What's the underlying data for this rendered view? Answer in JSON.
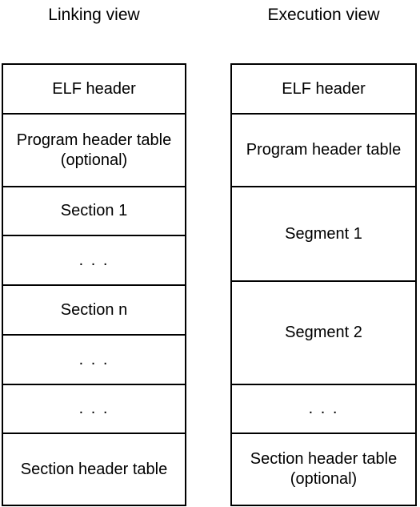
{
  "diagram": {
    "title_linking": "Linking view",
    "title_execution": "Execution view",
    "linking_view": {
      "title": "Linking view",
      "rows": [
        {
          "label": "ELF header",
          "height": 62,
          "kind": "header"
        },
        {
          "label": "Program header table (optional)",
          "height": 91,
          "kind": "table"
        },
        {
          "label": "Section 1",
          "height": 61,
          "kind": "section"
        },
        {
          "label": ". . .",
          "height": 62,
          "kind": "ellipsis"
        },
        {
          "label": "Section n",
          "height": 62,
          "kind": "section"
        },
        {
          "label": ". . .",
          "height": 62,
          "kind": "ellipsis"
        },
        {
          "label": ". . .",
          "height": 61,
          "kind": "ellipsis"
        },
        {
          "label": "Section header table",
          "height": 90,
          "kind": "table"
        }
      ]
    },
    "execution_view": {
      "title": "Execution view",
      "rows": [
        {
          "label": "ELF header",
          "height": 62,
          "kind": "header"
        },
        {
          "label": "Program header table",
          "height": 91,
          "kind": "table"
        },
        {
          "label": "Segment 1",
          "height": 118,
          "kind": "segment"
        },
        {
          "label": "Segment 2",
          "height": 129,
          "kind": "segment"
        },
        {
          "label": ". . .",
          "height": 61,
          "kind": "ellipsis"
        },
        {
          "label": "Section header table (optional)",
          "height": 90,
          "kind": "table"
        }
      ]
    },
    "colors": {
      "border": "#000000",
      "background": "#ffffff",
      "text": "#000000"
    }
  }
}
